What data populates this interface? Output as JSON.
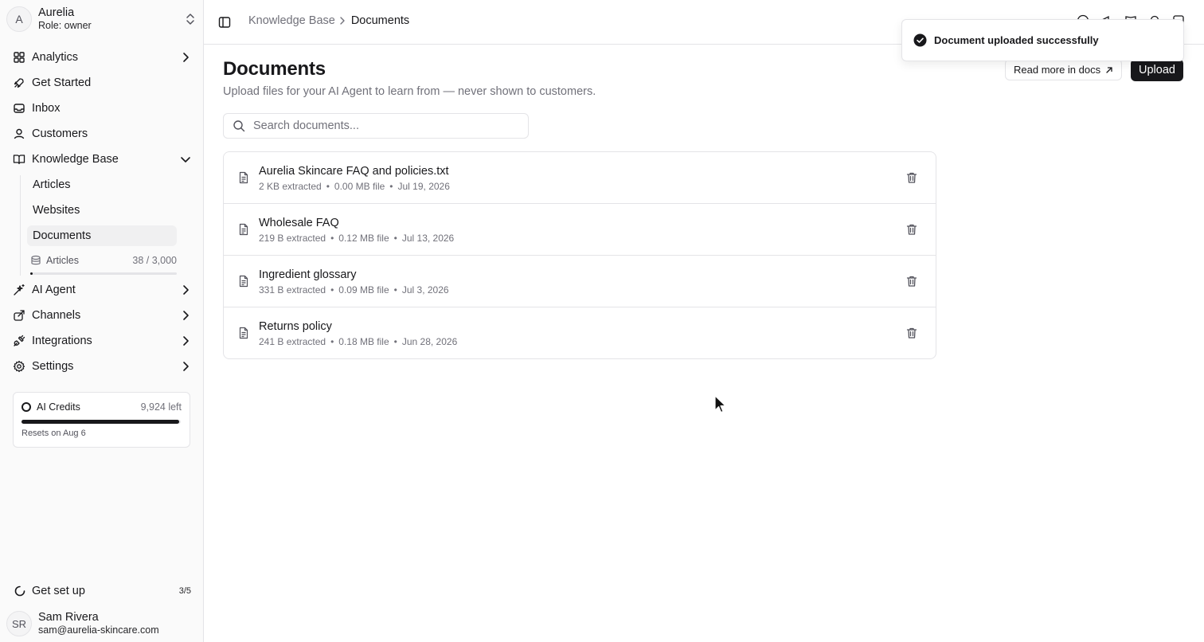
{
  "workspace": {
    "initial": "A",
    "name": "Aurelia",
    "role": "Role: owner"
  },
  "nav": {
    "analytics": "Analytics",
    "get_started": "Get Started",
    "inbox": "Inbox",
    "customers": "Customers",
    "knowledge_base": "Knowledge Base",
    "kb_items": [
      "Articles",
      "Websites",
      "Documents"
    ],
    "ai_agent": "AI Agent",
    "channels": "Channels",
    "integrations": "Integrations",
    "settings": "Settings"
  },
  "usage": {
    "label": "Articles",
    "count": "38 / 3,000",
    "fraction": 0.0127
  },
  "credits": {
    "label": "AI Credits",
    "left": "9,924 left",
    "reset": "Resets on Aug 6",
    "fraction": 0.99
  },
  "setup": {
    "label": "Get set up",
    "progress": "3/5"
  },
  "user": {
    "initials": "SR",
    "name": "Sam Rivera",
    "email": "sam@aurelia-skincare.com"
  },
  "breadcrumb": {
    "parent": "Knowledge Base",
    "current": "Documents"
  },
  "page": {
    "title": "Documents",
    "subtitle": "Upload files for your AI Agent to learn from — never shown to customers.",
    "docs_button": "Read more in docs",
    "upload_button": "Upload",
    "search_placeholder": "Search documents..."
  },
  "documents": [
    {
      "name": "Aurelia Skincare FAQ and policies.txt",
      "extracted": "2 KB extracted",
      "size": "0.00 MB file",
      "date": "Jul 19, 2026"
    },
    {
      "name": "Wholesale FAQ",
      "extracted": "219 B extracted",
      "size": "0.12 MB file",
      "date": "Jul 13, 2026"
    },
    {
      "name": "Ingredient glossary",
      "extracted": "331 B extracted",
      "size": "0.09 MB file",
      "date": "Jul 3, 2026"
    },
    {
      "name": "Returns policy",
      "extracted": "241 B extracted",
      "size": "0.18 MB file",
      "date": "Jun 28, 2026"
    }
  ],
  "meta_separator": "•",
  "toast": {
    "message": "Document uploaded successfully"
  },
  "colors": {
    "text": "#18181b",
    "muted": "#71717a",
    "border": "#e4e4e7",
    "sidebar_bg": "#fafafa",
    "primary": "#18181b"
  }
}
